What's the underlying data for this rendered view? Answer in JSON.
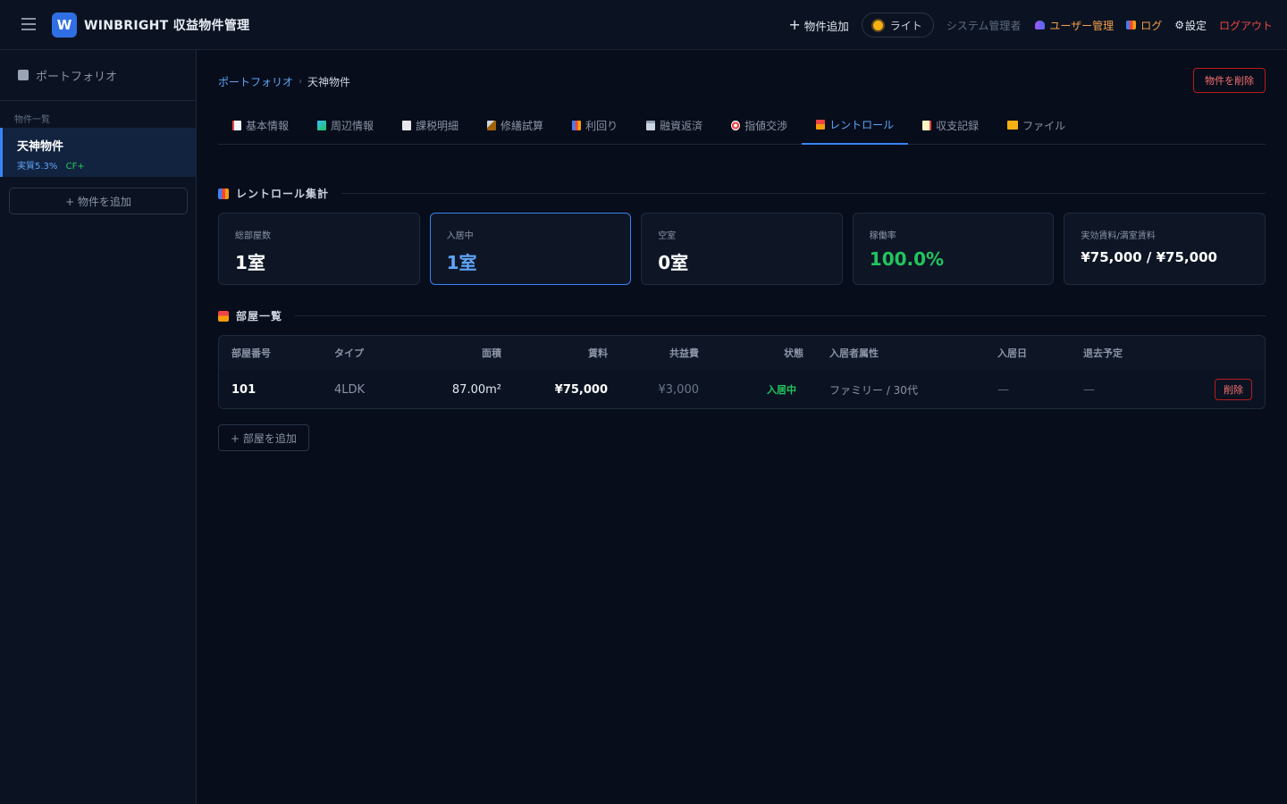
{
  "header": {
    "logo_letter": "W",
    "app_title": "WINBRIGHT 収益物件管理",
    "add_property": "物件追加",
    "theme_toggle": "ライト",
    "role": "システム管理者",
    "user_mgmt": "ユーザー管理",
    "log": "ログ",
    "settings": "設定",
    "logout": "ログアウト"
  },
  "sidebar": {
    "title": "ポートフォリオ",
    "section_label": "物件一覧",
    "items": [
      {
        "name": "天神物件",
        "yield": "実質5.3%",
        "cf": "CF+"
      }
    ],
    "add_button": "+ 物件を追加"
  },
  "breadcrumb": {
    "root": "ポートフォリオ",
    "current": "天神物件"
  },
  "delete_property": "物件を削除",
  "tabs": [
    {
      "label": "基本情報",
      "icon": "memo-icon"
    },
    {
      "label": "周辺情報",
      "icon": "map-icon"
    },
    {
      "label": "課税明細",
      "icon": "receipt-icon"
    },
    {
      "label": "修繕試算",
      "icon": "hammer-icon"
    },
    {
      "label": "利回り",
      "icon": "chart-icon"
    },
    {
      "label": "融資返済",
      "icon": "bank-icon"
    },
    {
      "label": "指値交渉",
      "icon": "target-icon"
    },
    {
      "label": "レントロール",
      "icon": "house-icon",
      "active": true
    },
    {
      "label": "収支記録",
      "icon": "document-icon"
    },
    {
      "label": "ファイル",
      "icon": "folder-icon"
    }
  ],
  "summary": {
    "title": "レントロール集計",
    "cards": [
      {
        "label": "総部屋数",
        "value": "1室"
      },
      {
        "label": "入居中",
        "value": "1室"
      },
      {
        "label": "空室",
        "value": "0室"
      },
      {
        "label": "稼働率",
        "value": "100.0%"
      },
      {
        "label": "実効賃料/満室賃料",
        "value": "¥75,000 / ¥75,000"
      }
    ]
  },
  "rooms": {
    "title": "部屋一覧",
    "columns": [
      "部屋番号",
      "タイプ",
      "面積",
      "賃料",
      "共益費",
      "状態",
      "入居者属性",
      "入居日",
      "退去予定"
    ],
    "rows": [
      {
        "room": "101",
        "type": "4LDK",
        "area": "87.00m²",
        "rent": "¥75,000",
        "fee": "¥3,000",
        "status": "入居中",
        "tenant": "ファミリー / 30代",
        "move_in": "—",
        "move_out": "—",
        "delete": "削除"
      }
    ],
    "add_button": "+ 部屋を追加"
  },
  "colors": {
    "accent": "#3b82f6",
    "success": "#22c55e",
    "danger": "#ef4444",
    "warning": "#f59e4a"
  }
}
